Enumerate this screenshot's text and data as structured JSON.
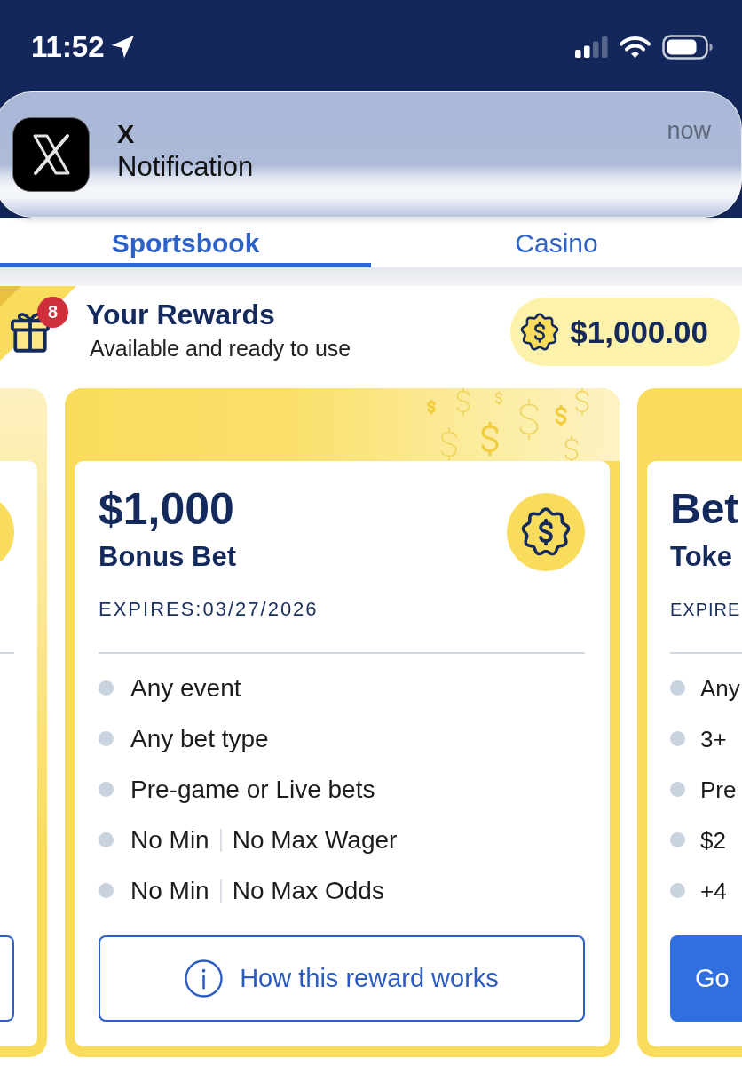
{
  "status_bar": {
    "time": "11:52"
  },
  "notification": {
    "title": "X",
    "message": "Notification",
    "time": "now"
  },
  "tabs": [
    {
      "label": "Sportsbook",
      "selected": true
    },
    {
      "label": "Casino",
      "selected": false
    }
  ],
  "rewards_header": {
    "title": "Your Rewards",
    "subtitle": "Available and ready to use",
    "count": "8",
    "balance": "$1,000.00"
  },
  "reward_cards": [
    {
      "kind": "previous",
      "coin_badge": true
    },
    {
      "kind": "current",
      "amount": "$1,000",
      "type": "Bonus Bet",
      "expires": "EXPIRES:03/27/2026",
      "coin_badge": true,
      "features": [
        {
          "parts": [
            "Any event"
          ]
        },
        {
          "parts": [
            "Any bet type"
          ]
        },
        {
          "parts": [
            "Pre-game or Live bets"
          ]
        },
        {
          "parts": [
            "No Min",
            "No Max Wager"
          ]
        },
        {
          "parts": [
            "No Min",
            "No Max Odds"
          ]
        }
      ],
      "button_label": "How this reward works"
    },
    {
      "kind": "next",
      "amount": "Bet",
      "type": "Toke",
      "expires": "EXPIRE",
      "features": [
        {
          "parts": [
            "Any"
          ]
        },
        {
          "parts": [
            "3+"
          ]
        },
        {
          "parts": [
            "Pre"
          ]
        },
        {
          "parts": [
            "$2"
          ]
        },
        {
          "parts": [
            "+4"
          ]
        }
      ],
      "button_label": "Go"
    }
  ]
}
